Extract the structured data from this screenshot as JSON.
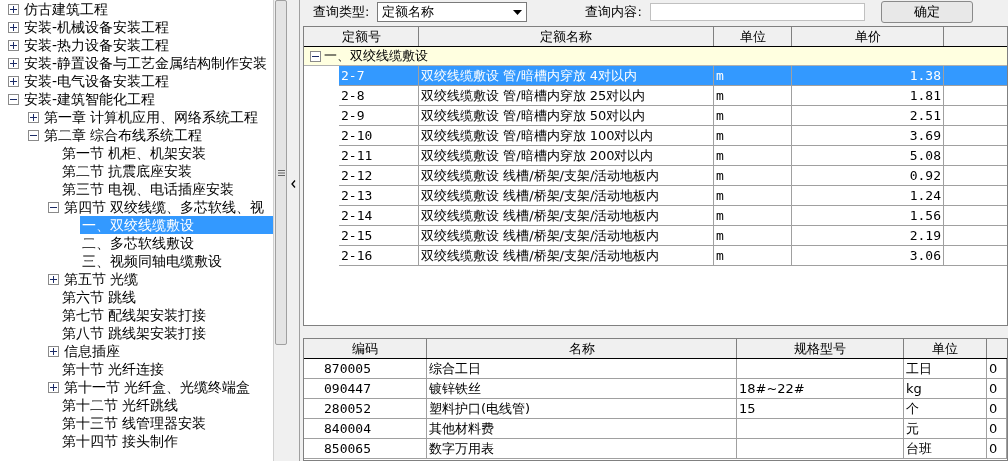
{
  "tree": [
    {
      "label": "仿古建筑工程",
      "expanded": false
    },
    {
      "label": "安装-机械设备安装工程",
      "expanded": false
    },
    {
      "label": "安装-热力设备安装工程",
      "expanded": false
    },
    {
      "label": "安装-静置设备与工艺金属结构制作安装",
      "expanded": false
    },
    {
      "label": "安装-电气设备安装工程",
      "expanded": false
    },
    {
      "label": "安装-建筑智能化工程",
      "expanded": true,
      "children": [
        {
          "label": "第一章 计算机应用、网络系统工程",
          "expanded": false
        },
        {
          "label": "第二章 综合布线系统工程",
          "expanded": true,
          "children": [
            {
              "label": "第一节 机柜、机架安装"
            },
            {
              "label": "第二节 抗震底座安装"
            },
            {
              "label": "第三节 电视、电话插座安装"
            },
            {
              "label": "第四节 双绞线缆、多芯软线、视",
              "expanded": true,
              "children": [
                {
                  "label": "一、双绞线缆敷设",
                  "selected": true
                },
                {
                  "label": "二、多芯软线敷设",
                  "selected": false
                },
                {
                  "label": "三、视频同轴电缆敷设",
                  "selected": false
                }
              ]
            },
            {
              "label": "第五节 光缆",
              "expanded": false
            },
            {
              "label": "第六节 跳线"
            },
            {
              "label": "第七节 配线架安装打接"
            },
            {
              "label": "第八节 跳线架安装打接"
            },
            {
              "label": "信息插座",
              "expanded": false
            },
            {
              "label": "第十节 光纤连接"
            },
            {
              "label": "第十一节 光纤盒、光缆终端盒",
              "expanded": false
            },
            {
              "label": "第十二节 光纤跳线"
            },
            {
              "label": "第十三节 线管理器安装"
            },
            {
              "label": "第十四节 接头制作"
            }
          ]
        }
      ]
    }
  ],
  "query": {
    "type_label": "查询类型:",
    "type_value": "定额名称",
    "content_label": "查询内容:",
    "confirm": "确定"
  },
  "quota_table": {
    "columns": [
      "定额号",
      "定额名称",
      "单位",
      "单价"
    ],
    "group": "一、双绞线缆敷设",
    "rows": [
      {
        "cells": [
          "2-7",
          "双绞线缆敷设 管/暗槽内穿放 4对以内",
          "m",
          "1.38"
        ],
        "selected": true
      },
      {
        "cells": [
          "2-8",
          "双绞线缆敷设 管/暗槽内穿放 25对以内",
          "m",
          "1.81"
        ],
        "selected": false
      },
      {
        "cells": [
          "2-9",
          "双绞线缆敷设 管/暗槽内穿放 50对以内",
          "m",
          "2.51"
        ],
        "selected": false
      },
      {
        "cells": [
          "2-10",
          "双绞线缆敷设 管/暗槽内穿放 100对以内",
          "m",
          "3.69"
        ],
        "selected": false
      },
      {
        "cells": [
          "2-11",
          "双绞线缆敷设 管/暗槽内穿放 200对以内",
          "m",
          "5.08"
        ],
        "selected": false
      },
      {
        "cells": [
          "2-12",
          "双绞线缆敷设 线槽/桥架/支架/活动地板内",
          "m",
          "0.92"
        ],
        "selected": false
      },
      {
        "cells": [
          "2-13",
          "双绞线缆敷设 线槽/桥架/支架/活动地板内",
          "m",
          "1.24"
        ],
        "selected": false
      },
      {
        "cells": [
          "2-14",
          "双绞线缆敷设 线槽/桥架/支架/活动地板内",
          "m",
          "1.56"
        ],
        "selected": false
      },
      {
        "cells": [
          "2-15",
          "双绞线缆敷设 线槽/桥架/支架/活动地板内",
          "m",
          "2.19"
        ],
        "selected": false
      },
      {
        "cells": [
          "2-16",
          "双绞线缆敷设 线槽/桥架/支架/活动地板内",
          "m",
          "3.06"
        ],
        "selected": false
      }
    ]
  },
  "material_table": {
    "columns": [
      "编码",
      "名称",
      "规格型号",
      "单位"
    ],
    "rows": [
      [
        "870005",
        "综合工日",
        "",
        "工日",
        "0"
      ],
      [
        "090447",
        "镀锌铁丝",
        "18#~22#",
        "kg",
        "0"
      ],
      [
        "280052",
        "塑料护口(电线管)",
        "15",
        "个",
        "0"
      ],
      [
        "840004",
        "其他材料费",
        "",
        "元",
        "0"
      ],
      [
        "850065",
        "数字万用表",
        "",
        "台班",
        "0"
      ]
    ]
  }
}
